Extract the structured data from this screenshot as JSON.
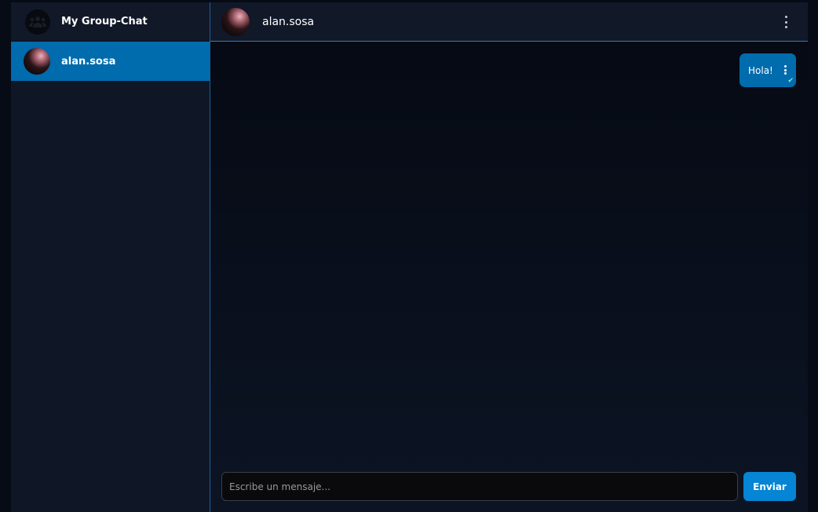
{
  "sidebar": {
    "group": {
      "name": "My Group-Chat",
      "icon": "group-icon"
    },
    "contacts": [
      {
        "name": "alan.sosa",
        "active": true
      }
    ]
  },
  "chat": {
    "header": {
      "name": "alan.sosa"
    },
    "messages": [
      {
        "text": "Hola!",
        "status": "read"
      }
    ],
    "input": {
      "placeholder": "Escribe un mensaje...",
      "value": ""
    },
    "send_label": "Enviar"
  },
  "colors": {
    "accent": "#006bad",
    "send": "#0585d4"
  }
}
